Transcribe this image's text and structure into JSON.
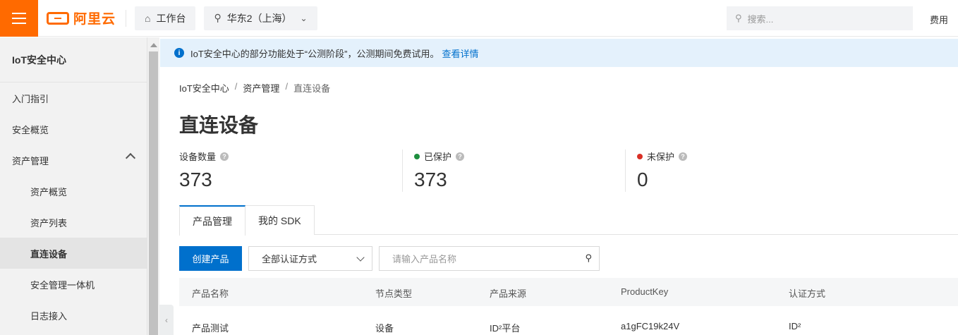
{
  "topbar": {
    "logo_text": "阿里云",
    "workbench_label": "工作台",
    "region_label": "华东2（上海）",
    "search_placeholder": "搜索...",
    "fee_label": "费用",
    "brand_color": "#ff6a00"
  },
  "sidebar": {
    "title": "IoT安全中心",
    "items": [
      {
        "label": "入门指引"
      },
      {
        "label": "安全概览"
      },
      {
        "label": "资产管理"
      },
      {
        "label": "资产概览"
      },
      {
        "label": "资产列表"
      },
      {
        "label": "直连设备"
      },
      {
        "label": "安全管理一体机"
      },
      {
        "label": "日志接入"
      }
    ]
  },
  "notice": {
    "text": "IoT安全中心的部分功能处于“公测阶段”，公测期间免费试用。",
    "link": "查看详情"
  },
  "breadcrumb": [
    "IoT安全中心",
    "资产管理",
    "直连设备"
  ],
  "page_title": "直连设备",
  "stats": [
    {
      "label": "设备数量",
      "value": "373"
    },
    {
      "label": "已保护",
      "value": "373",
      "color": "#1e8e3e"
    },
    {
      "label": "未保护",
      "value": "0",
      "color": "#d93026"
    }
  ],
  "tabs": [
    "产品管理",
    "我的 SDK"
  ],
  "toolbar": {
    "create_label": "创建产品",
    "auth_select_value": "全部认证方式",
    "search_placeholder": "请输入产品名称"
  },
  "table": {
    "columns": [
      "产品名称",
      "节点类型",
      "产品来源",
      "ProductKey",
      "认证方式"
    ],
    "rows": [
      [
        "产品测试",
        "设备",
        "ID²平台",
        "a1gFC19k24V",
        "ID²"
      ]
    ]
  },
  "accent_color": "#0070cc"
}
